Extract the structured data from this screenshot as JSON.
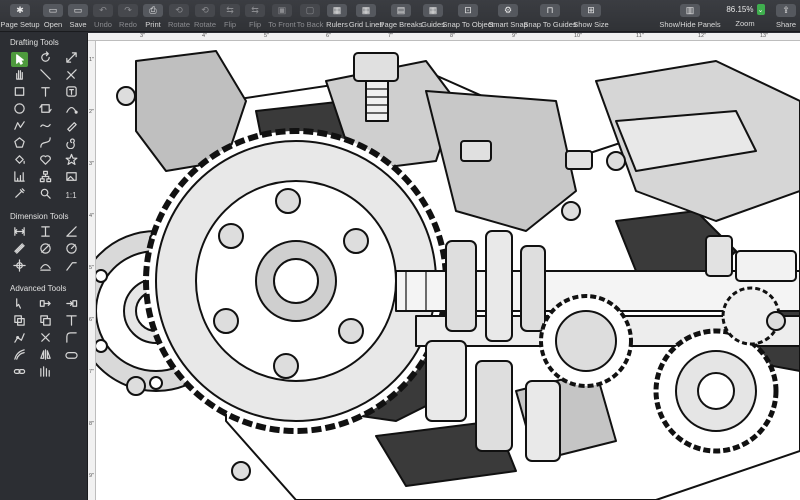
{
  "toolbar": {
    "items": [
      {
        "label": "Page Setup",
        "icon": "gear-icon"
      },
      {
        "label": "Open",
        "icon": "folder-icon"
      },
      {
        "label": "Save",
        "icon": "save-icon"
      },
      {
        "label": "Undo",
        "icon": "undo-icon"
      },
      {
        "label": "Redo",
        "icon": "redo-icon"
      },
      {
        "label": "Print",
        "icon": "printer-icon"
      },
      {
        "label": "Rotate",
        "icon": "rotate-icon"
      },
      {
        "label": "Rotate",
        "icon": "rotate-icon"
      },
      {
        "label": "Flip",
        "icon": "flip-icon"
      },
      {
        "label": "Flip",
        "icon": "flip-icon"
      },
      {
        "label": "To Front",
        "icon": "to-front-icon"
      },
      {
        "label": "To Back",
        "icon": "to-back-icon"
      },
      {
        "label": "Rulers",
        "icon": "ruler-icon"
      },
      {
        "label": "Grid Lines",
        "icon": "grid-icon"
      },
      {
        "label": "Page Breaks",
        "icon": "page-breaks-icon"
      },
      {
        "label": "Guides",
        "icon": "guides-icon"
      },
      {
        "label": "Snap To Object",
        "icon": "snap-object-icon"
      },
      {
        "label": "Smart Snap",
        "icon": "smart-snap-icon"
      },
      {
        "label": "Snap To Guides",
        "icon": "snap-guides-icon"
      },
      {
        "label": "Show Size",
        "icon": "show-size-icon"
      },
      {
        "label": "Show/Hide Panels",
        "icon": "panels-icon"
      },
      {
        "label": "Share",
        "icon": "share-icon"
      }
    ],
    "zoom_value": "86.15%",
    "zoom_label": "Zoom"
  },
  "sidebar": {
    "drafting_title": "Drafting Tools",
    "dimension_title": "Dimension Tools",
    "advanced_title": "Advanced Tools",
    "scale_label": "1:1"
  },
  "ruler_h": [
    "3\"",
    "4\"",
    "5\"",
    "6\"",
    "7\"",
    "8\"",
    "9\"",
    "10\"",
    "11\"",
    "12\"",
    "13\""
  ],
  "ruler_v": [
    "1\"",
    "2\"",
    "3\"",
    "4\"",
    "5\"",
    "6\"",
    "7\"",
    "8\"",
    "9\""
  ],
  "colors": {
    "accent": "#4e9a3d",
    "zoom_stepper": "#3fae4e",
    "sidebar_bg": "#2c2e33",
    "toolbar_bg": "#36383c"
  }
}
